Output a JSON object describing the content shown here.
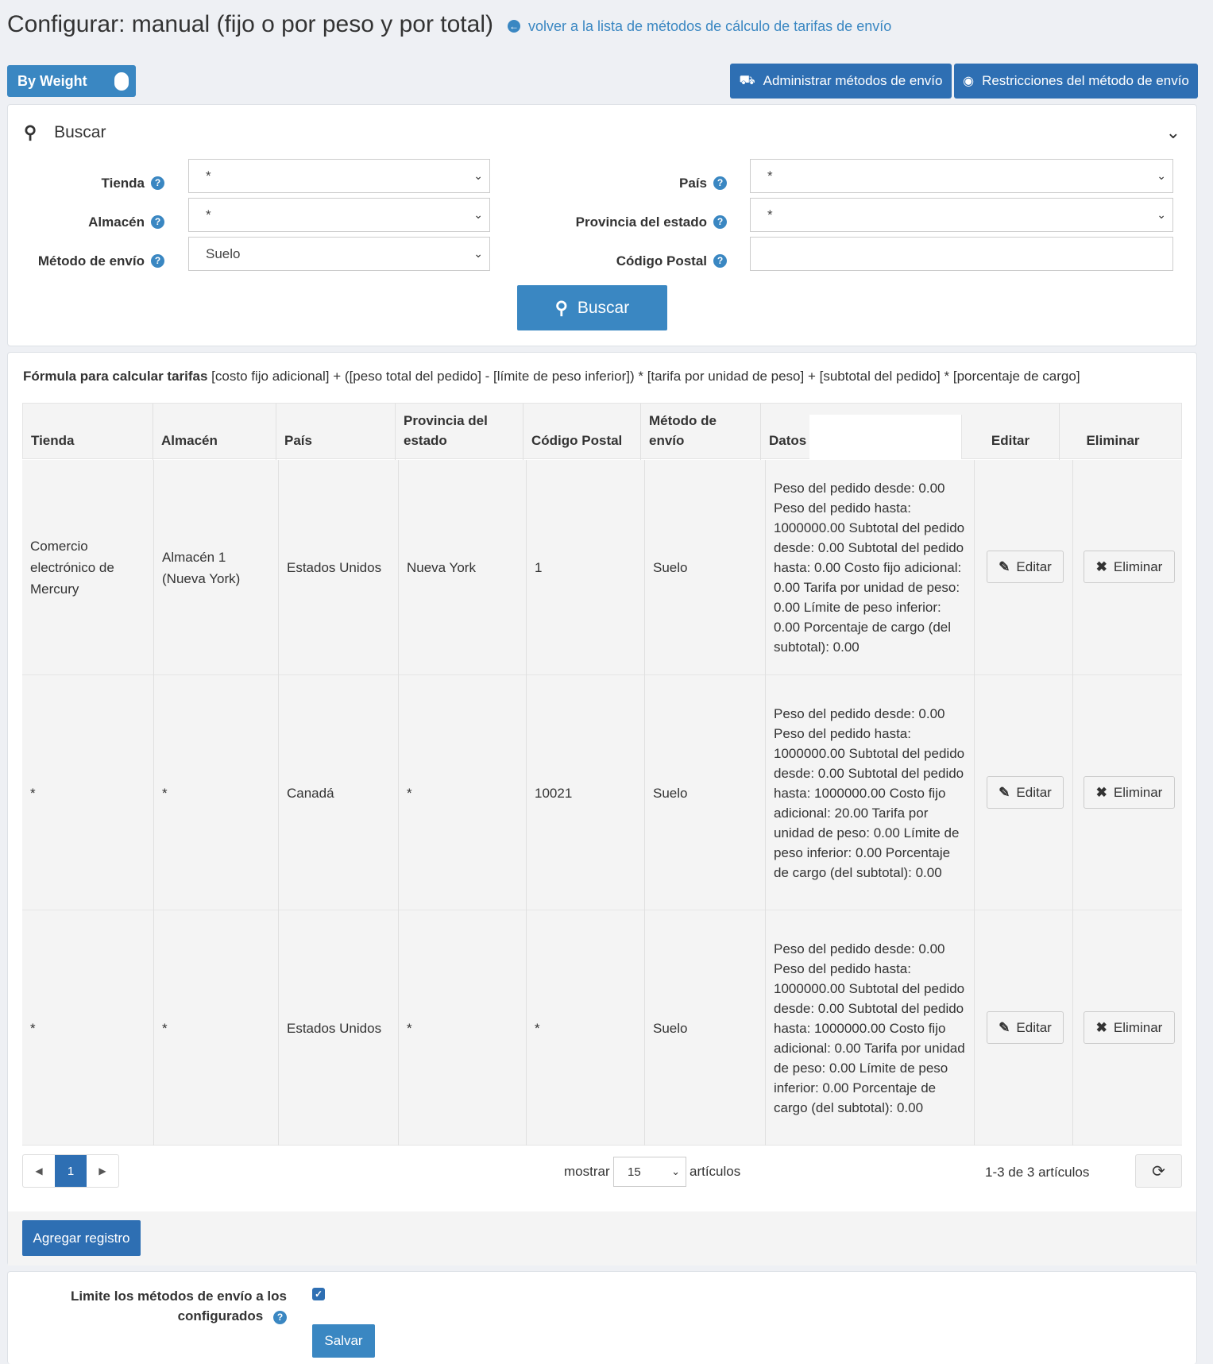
{
  "header": {
    "title": "Configurar: manual (fijo o por peso y por total)",
    "back_link": "volver a la lista de métodos de cálculo de tarifas de envío"
  },
  "toggle": {
    "label": "By Weight",
    "on": true
  },
  "top_buttons": {
    "manage": "Administrar métodos de envío",
    "restrictions": "Restricciones del método de envío"
  },
  "search": {
    "title": "Buscar",
    "fields": {
      "tienda": {
        "label": "Tienda",
        "value": "*"
      },
      "almacen": {
        "label": "Almacén",
        "value": "*"
      },
      "metodo": {
        "label": "Método de envío",
        "value": "Suelo"
      },
      "pais": {
        "label": "País",
        "value": "*"
      },
      "provincia": {
        "label": "Provincia del estado",
        "value": "*"
      },
      "codigo": {
        "label": "Código Postal",
        "value": ""
      }
    },
    "button": "Buscar"
  },
  "formula": {
    "label": "Fórmula para calcular tarifas",
    "text": "[costo fijo adicional] + ([peso total del pedido] - [límite de peso inferior]) * [tarifa por unidad de peso] + [subtotal del pedido] * [porcentaje de cargo]"
  },
  "table": {
    "columns": [
      "Tienda",
      "Almacén",
      "País",
      "Provincia del estado",
      "Código Postal",
      "Método de envío",
      "Datos",
      "",
      "Editar",
      "Eliminar"
    ],
    "edit_label": "Editar",
    "delete_label": "Eliminar",
    "rows": [
      {
        "tienda": "Comercio electrónico de Mercury",
        "almacen": "Almacén 1 (Nueva York)",
        "pais": "Estados Unidos",
        "provincia": "Nueva York",
        "codigo": "1",
        "metodo": "Suelo",
        "datos": "Peso del pedido desde: 0.00 Peso del pedido hasta: 1000000.00 Subtotal del pedido desde: 0.00 Subtotal del pedido hasta: 0.00 Costo fijo adicional: 0.00 Tarifa por unidad de peso: 0.00 Límite de peso inferior: 0.00 Porcentaje de cargo (del subtotal): 0.00"
      },
      {
        "tienda": "*",
        "almacen": "*",
        "pais": "Canadá",
        "provincia": "*",
        "codigo": "10021",
        "metodo": "Suelo",
        "datos": "Peso del pedido desde: 0.00 Peso del pedido hasta: 1000000.00 Subtotal del pedido desde: 0.00 Subtotal del pedido hasta: 1000000.00 Costo fijo adicional: 20.00 Tarifa por unidad de peso: 0.00 Límite de peso inferior: 0.00 Porcentaje de cargo (del subtotal): 0.00"
      },
      {
        "tienda": "*",
        "almacen": "*",
        "pais": "Estados Unidos",
        "provincia": "*",
        "codigo": "*",
        "metodo": "Suelo",
        "datos": "Peso del pedido desde: 0.00 Peso del pedido hasta: 1000000.00 Subtotal del pedido desde: 0.00 Subtotal del pedido hasta: 1000000.00 Costo fijo adicional: 0.00 Tarifa por unidad de peso: 0.00 Límite de peso inferior: 0.00 Porcentaje de cargo (del subtotal): 0.00"
      }
    ]
  },
  "pagination": {
    "current_page": "1",
    "show_label": "mostrar",
    "per_page": "15",
    "items_label": "artículos",
    "count": "1-3 de 3 artículos"
  },
  "add_button": "Agregar registro",
  "limit": {
    "label": "Limite los métodos de envío a los configurados",
    "checked": true
  },
  "save_button": "Salvar",
  "colors": {
    "primary": "#3a87c2",
    "primary_dark": "#2e6fb3",
    "background": "#eef0f4"
  }
}
